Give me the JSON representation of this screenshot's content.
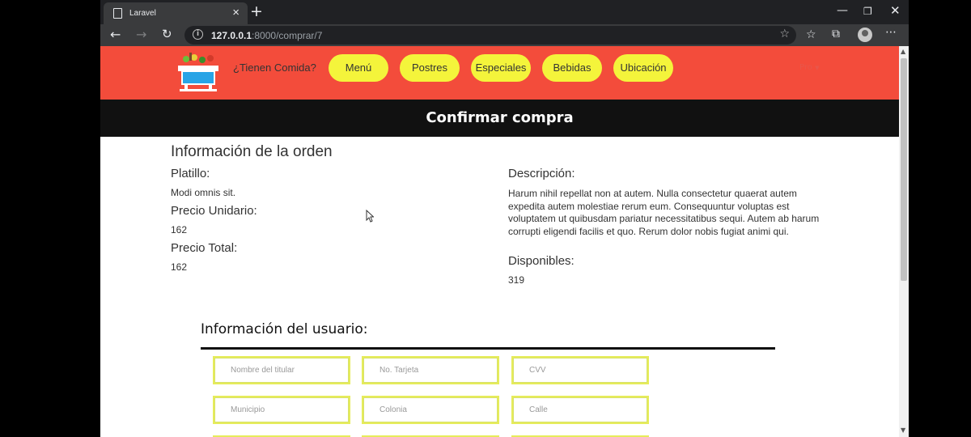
{
  "tab": {
    "title": "Laravel"
  },
  "omnibox": {
    "host": "127.0.0.1",
    "path": ":8000/comprar/7"
  },
  "icons": {
    "back": "back-arrow-icon",
    "forward": "forward-arrow-icon",
    "reload": "reload-icon",
    "info": "info-icon",
    "star": "favorite-star-icon",
    "collections": "collections-icon",
    "favorites": "favorites-icon",
    "profile": "profile-avatar-icon",
    "more": "more-dots-icon"
  },
  "nav": {
    "brand": "¿Tienen Comida?",
    "items": [
      "Menú",
      "Postres",
      "Especiales",
      "Bebidas",
      "Ubicación"
    ],
    "lang": "Pro"
  },
  "page": {
    "heading": "Confirmar compra",
    "order_title": "Información de la orden",
    "platillo_label": "Platillo:",
    "platillo_value": "Modi omnis sit.",
    "precio_unitario_label": "Precio Unidario:",
    "precio_unitario_value": "162",
    "precio_total_label": "Precio Total:",
    "precio_total_value": "162",
    "descripcion_label": "Descripción:",
    "descripcion_value": "Harum nihil repellat non at autem. Nulla consectetur quaerat autem expedita autem molestiae rerum eum. Consequuntur voluptas est voluptatem ut quibusdam pariatur necessitatibus sequi. Autem ab harum corrupti eligendi facilis et quo. Rerum dolor nobis fugiat animi qui.",
    "disponibles_label": "Disponibles:",
    "disponibles_value": "319"
  },
  "user_form": {
    "title": "Información del usuario:",
    "nombre_placeholder": "Nombre del titular",
    "tarjeta_placeholder": "No. Tarjeta",
    "cvv_placeholder": "CVV",
    "municipio_placeholder": "Municipio",
    "colonia_placeholder": "Colonia",
    "calle_placeholder": "Calle"
  },
  "colors": {
    "navbar": "#f34c3b",
    "nav_button": "#f4f43b",
    "header_bar": "#111111",
    "field_border": "#e6ec5a"
  }
}
